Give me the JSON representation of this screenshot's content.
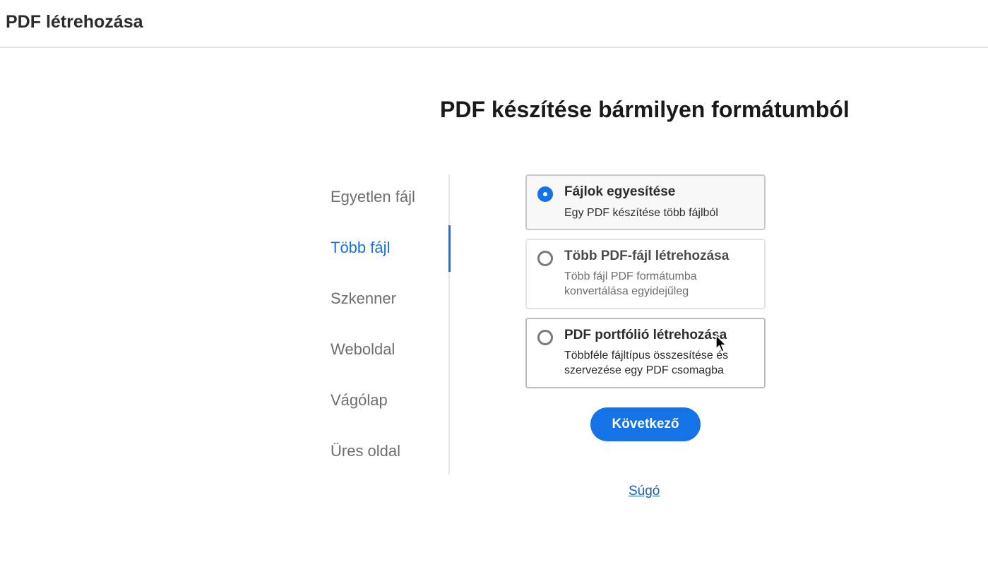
{
  "header": {
    "title": "PDF létrehozása"
  },
  "main": {
    "heading": "PDF készítése bármilyen formátumból"
  },
  "sidebar": {
    "items": [
      {
        "label": "Egyetlen fájl",
        "active": false
      },
      {
        "label": "Több fájl",
        "active": true
      },
      {
        "label": "Szkenner",
        "active": false
      },
      {
        "label": "Weboldal",
        "active": false
      },
      {
        "label": "Vágólap",
        "active": false
      },
      {
        "label": "Üres oldal",
        "active": false
      }
    ]
  },
  "options": [
    {
      "title": "Fájlok egyesítése",
      "description": "Egy PDF készítése több fájlból",
      "selected": true
    },
    {
      "title": "Több PDF-fájl létrehozása",
      "description": "Több fájl PDF formátumba konvertálása egyidejűleg",
      "selected": false
    },
    {
      "title": "PDF portfólió létrehozása",
      "description": "Többféle fájltípus összesítése és szervezése egy PDF csomagba",
      "selected": false
    }
  ],
  "actions": {
    "next_label": "Következő",
    "help_label": "Súgó"
  },
  "colors": {
    "accent": "#1473e6",
    "link": "#1d5fa8",
    "divider": "#e3e3e3"
  },
  "icons": {
    "radio_selected": "radio-selected-icon",
    "radio_unselected": "radio-unselected-icon",
    "cursor": "mouse-pointer-icon"
  }
}
